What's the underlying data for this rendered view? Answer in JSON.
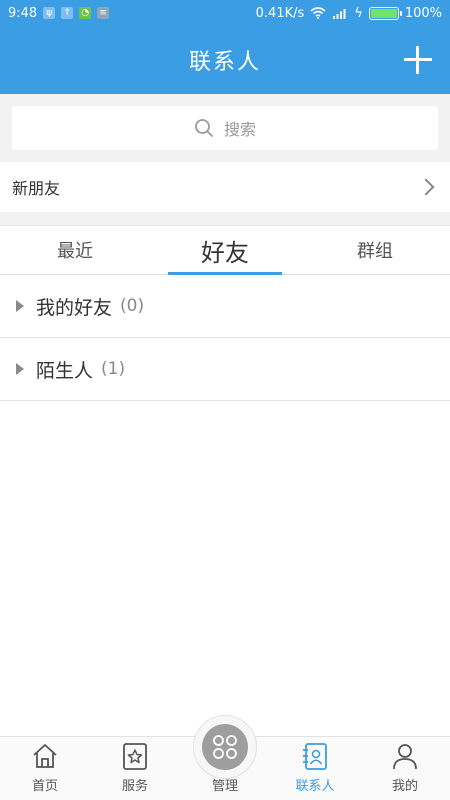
{
  "status": {
    "time": "9:48",
    "speed": "0.41K/s",
    "battery": "100%",
    "battery_level": 1.0
  },
  "header": {
    "title": "联系人"
  },
  "search": {
    "placeholder": "搜索"
  },
  "new_friend": {
    "label": "新朋友"
  },
  "tabs": [
    {
      "label": "最近"
    },
    {
      "label": "好友"
    },
    {
      "label": "群组"
    }
  ],
  "groups": [
    {
      "name": "我的好友",
      "count": "(0)"
    },
    {
      "name": "陌生人",
      "count": "(1)"
    }
  ],
  "tabbar": [
    {
      "label": "首页"
    },
    {
      "label": "服务"
    },
    {
      "label": "管理"
    },
    {
      "label": "联系人"
    },
    {
      "label": "我的"
    }
  ],
  "colors": {
    "accent": "#3b9de3"
  }
}
